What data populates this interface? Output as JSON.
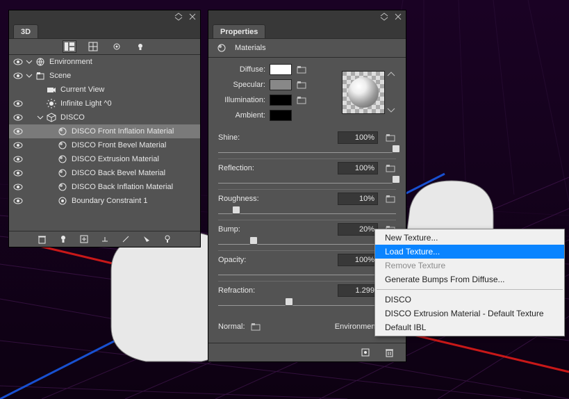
{
  "panels": {
    "scene": {
      "title": "3D",
      "toolbar": {
        "btn1": "panel-layout",
        "btn2": "grid",
        "btn3": "render",
        "btn4": "light"
      },
      "rows": [
        {
          "vis": true,
          "expand": "open",
          "depth": 1,
          "icon": "environment",
          "label": "Environment",
          "sel": false
        },
        {
          "vis": true,
          "expand": "open",
          "depth": 1,
          "icon": "scene",
          "label": "Scene",
          "sel": false
        },
        {
          "vis": false,
          "expand": "none",
          "depth": 2,
          "icon": "camera",
          "label": "Current View",
          "sel": false
        },
        {
          "vis": true,
          "expand": "none",
          "depth": 2,
          "icon": "light",
          "label": "Infinite Light ^0",
          "sel": false
        },
        {
          "vis": true,
          "expand": "open",
          "depth": 2,
          "icon": "mesh",
          "label": "DISCO",
          "sel": false
        },
        {
          "vis": true,
          "expand": "none",
          "depth": 3,
          "icon": "material",
          "label": "DISCO Front Inflation Material",
          "sel": true
        },
        {
          "vis": true,
          "expand": "none",
          "depth": 3,
          "icon": "material",
          "label": "DISCO Front Bevel Material",
          "sel": false
        },
        {
          "vis": true,
          "expand": "none",
          "depth": 3,
          "icon": "material",
          "label": "DISCO Extrusion Material",
          "sel": false
        },
        {
          "vis": true,
          "expand": "none",
          "depth": 3,
          "icon": "material",
          "label": "DISCO Back Bevel Material",
          "sel": false
        },
        {
          "vis": true,
          "expand": "none",
          "depth": 3,
          "icon": "material",
          "label": "DISCO Back Inflation Material",
          "sel": false
        },
        {
          "vis": true,
          "expand": "none",
          "depth": 3,
          "icon": "constraint",
          "label": "Boundary Constraint 1",
          "sel": false
        }
      ]
    },
    "props": {
      "title": "Properties",
      "section": "Materials",
      "colors": {
        "diffuse": {
          "label": "Diffuse:"
        },
        "specular": {
          "label": "Specular:"
        },
        "illumination": {
          "label": "Illumination:"
        },
        "ambient": {
          "label": "Ambient:"
        }
      },
      "sliders": {
        "shine": {
          "label": "Shine:",
          "value": "100%",
          "pos": 100
        },
        "reflection": {
          "label": "Reflection:",
          "value": "100%",
          "pos": 100
        },
        "roughness": {
          "label": "Roughness:",
          "value": "10%",
          "pos": 10
        },
        "bump": {
          "label": "Bump:",
          "value": "20%",
          "pos": 20
        },
        "opacity": {
          "label": "Opacity:",
          "value": "100%",
          "pos": 100
        },
        "refraction": {
          "label": "Refraction:",
          "value": "1.299",
          "pos": 40
        }
      },
      "normal": {
        "label": "Normal:"
      },
      "environment": {
        "label": "Environment:"
      }
    }
  },
  "menu": {
    "items": [
      {
        "label": "New Texture...",
        "state": "normal"
      },
      {
        "label": "Load Texture...",
        "state": "selected"
      },
      {
        "label": "Remove Texture",
        "state": "disabled"
      },
      {
        "label": "Generate Bumps From Diffuse...",
        "state": "normal"
      },
      {
        "sep": true
      },
      {
        "label": "DISCO",
        "state": "normal"
      },
      {
        "label": "DISCO Extrusion Material - Default Texture",
        "state": "normal"
      },
      {
        "label": "Default IBL",
        "state": "normal"
      }
    ]
  }
}
